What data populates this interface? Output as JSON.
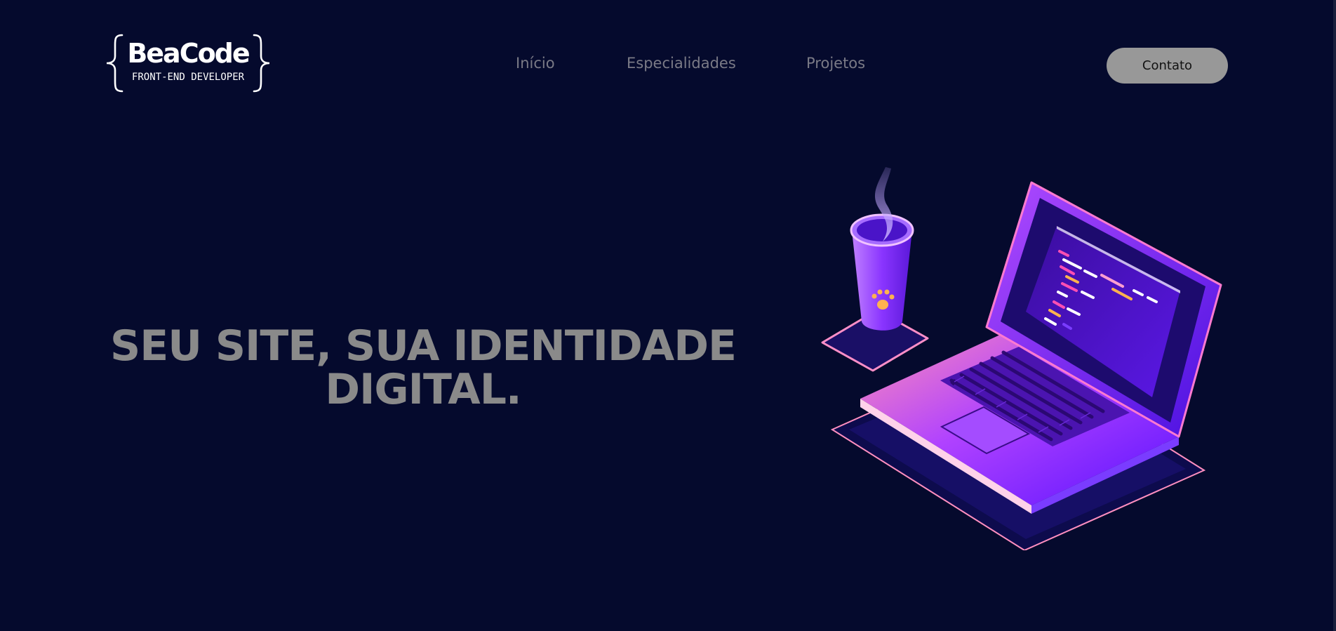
{
  "brand": {
    "name": "BeaCode",
    "tagline": "FRONT-END DEVELOPER"
  },
  "nav": {
    "items": [
      {
        "label": "Início"
      },
      {
        "label": "Especialidades"
      },
      {
        "label": "Projetos"
      }
    ],
    "cta_label": "Contato"
  },
  "hero": {
    "title_line1": "SEU SITE, SUA IDENTIDADE",
    "title_line2": "DIGITAL."
  },
  "colors": {
    "background": "#050a2d",
    "nav_text": "#7a7a86",
    "cta_bg": "#989898",
    "hero_text": "#8a8a8a",
    "accent_purple": "#6a1bff",
    "accent_pink": "#ff6fb0"
  }
}
